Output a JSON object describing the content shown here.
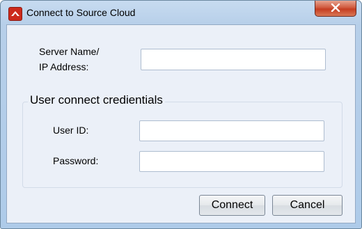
{
  "window": {
    "title": "Connect to Source Cloud"
  },
  "form": {
    "server_label_line1": "Server Name/",
    "server_label_line2": "IP Address:",
    "server_value": "",
    "group_title": "User connect credientials",
    "user_id_label": "User ID:",
    "user_id_value": "",
    "password_label": "Password:",
    "password_value": ""
  },
  "buttons": {
    "connect": "Connect",
    "cancel": "Cancel"
  },
  "colors": {
    "close_button": "#c53d21",
    "app_icon": "#cc2a1c",
    "client_bg": "#ebf0f8"
  }
}
